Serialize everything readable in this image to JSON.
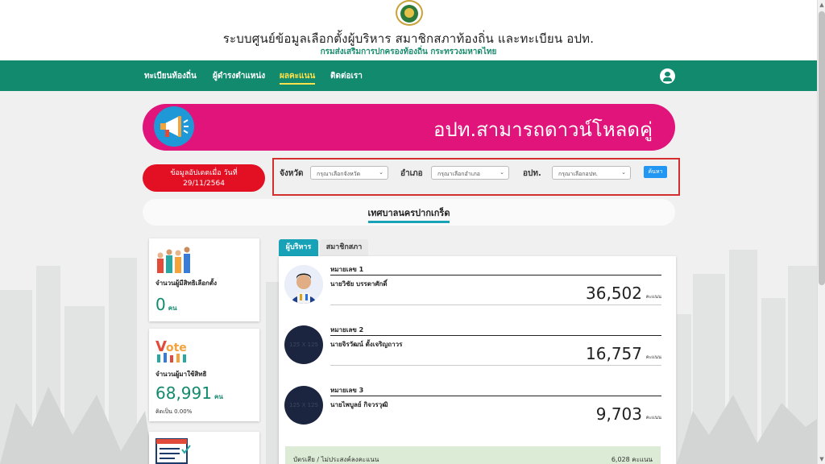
{
  "header": {
    "title": "ระบบศูนย์ข้อมูลเลือกตั้งผู้บริหาร สมาชิกสภาท้องถิ่น และทะเบียน อปท.",
    "subtitle": "กรมส่งเสริมการปกครองท้องถิ่น กระทรวงมหาดไทย"
  },
  "nav": {
    "items": [
      {
        "label": "ทะเบียนท้องถิ่น"
      },
      {
        "label": "ผู้ดำรงตำแหน่ง"
      },
      {
        "label": "ผลคะแนน"
      },
      {
        "label": "ติดต่อเรา"
      }
    ]
  },
  "banner": {
    "text": "อปท.สามารถดาวน์โหลดคู่"
  },
  "update": {
    "line1": "ข้อมูลอัปเดตเมื่อ วันที่",
    "line2": "29/11/2564"
  },
  "filter": {
    "province_label": "จังหวัด",
    "province_placeholder": "กรุณาเลือกจังหวัด",
    "district_label": "อำเภอ",
    "district_placeholder": "กรุณาเลือกอำเภอ",
    "lao_label": "อปท.",
    "lao_placeholder": "กรุณาเลือกอปท.",
    "search_label": "ค้นหา"
  },
  "municipality": {
    "name": "เทศบาลนครปากเกร็ด"
  },
  "stats": {
    "eligible": {
      "title": "จำนวนผู้มีสิทธิเลือกตั้ง",
      "value": "0",
      "unit": "คน"
    },
    "voted": {
      "title": "จำนวนผู้มาใช้สิทธิ",
      "value": "68,991",
      "unit": "คน",
      "percent": "คิดเป็น 0.00%"
    }
  },
  "tabs": {
    "executive": "ผู้บริหาร",
    "council": "สมาชิกสภา"
  },
  "candidates": [
    {
      "number": "หมายเลข 1",
      "name": "นายวิชัย บรรดาศักดิ์",
      "votes": "36,502",
      "unit": "คะแนน",
      "avatar_text": ""
    },
    {
      "number": "หมายเลข 2",
      "name": "นายจิรวัฒน์ ตั้งเจริญถาวร",
      "votes": "16,757",
      "unit": "คะแนน",
      "avatar_text": "125 X 125"
    },
    {
      "number": "หมายเลข 3",
      "name": "นายไพบูลย์ กิจวรวุฒิ",
      "votes": "9,703",
      "unit": "คะแนน",
      "avatar_text": "125 X 125"
    }
  ],
  "invalid": {
    "label": "บัตรเสีย / ไม่ประสงค์ลงคะแนน",
    "value": "6,028 คะแนน"
  },
  "colors": {
    "nav": "#128a6e",
    "banner": "#e0147a",
    "badge": "#e30f22",
    "tab": "#17a2b8",
    "accent": "#ffe24a"
  }
}
